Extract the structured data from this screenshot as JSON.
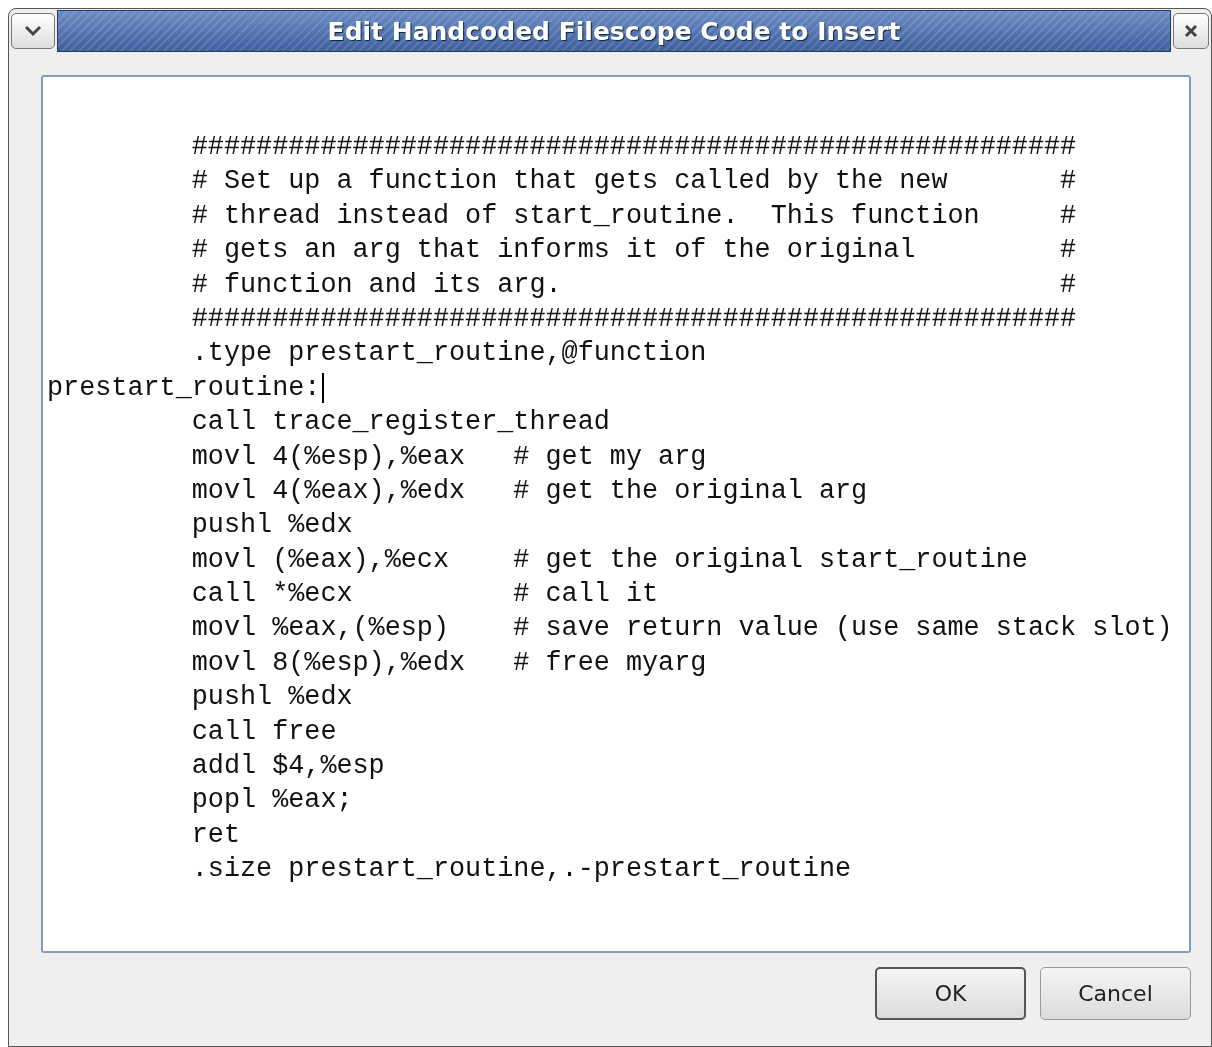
{
  "window": {
    "title": "Edit Handcoded Filescope Code to Insert"
  },
  "editor": {
    "lines": [
      {
        "text": "\t#######################################################",
        "cursor": false
      },
      {
        "text": "\t# Set up a function that gets called by the new       #",
        "cursor": false
      },
      {
        "text": "\t# thread instead of start_routine.  This function     #",
        "cursor": false
      },
      {
        "text": "\t# gets an arg that informs it of the original         #",
        "cursor": false
      },
      {
        "text": "\t# function and its arg.                               #",
        "cursor": false
      },
      {
        "text": "\t#######################################################",
        "cursor": false
      },
      {
        "text": "\t.type prestart_routine,@function",
        "cursor": false
      },
      {
        "text": "prestart_routine:",
        "cursor": true
      },
      {
        "text": "\tcall trace_register_thread",
        "cursor": false
      },
      {
        "text": "\tmovl 4(%esp),%eax   # get my arg",
        "cursor": false
      },
      {
        "text": "\tmovl 4(%eax),%edx   # get the original arg",
        "cursor": false
      },
      {
        "text": "\tpushl %edx",
        "cursor": false
      },
      {
        "text": "\tmovl (%eax),%ecx    # get the original start_routine",
        "cursor": false
      },
      {
        "text": "\tcall *%ecx          # call it",
        "cursor": false
      },
      {
        "text": "\tmovl %eax,(%esp)    # save return value (use same stack slot)",
        "cursor": false
      },
      {
        "text": "\tmovl 8(%esp),%edx   # free myarg",
        "cursor": false
      },
      {
        "text": "\tpushl %edx",
        "cursor": false
      },
      {
        "text": "\tcall free",
        "cursor": false
      },
      {
        "text": "\taddl $4,%esp",
        "cursor": false
      },
      {
        "text": "\tpopl %eax;",
        "cursor": false
      },
      {
        "text": "\tret",
        "cursor": false
      },
      {
        "text": "\t.size prestart_routine,.-prestart_routine",
        "cursor": false
      }
    ]
  },
  "buttons": [
    {
      "label": "OK",
      "kind": "default"
    },
    {
      "label": "Cancel",
      "kind": "normal"
    }
  ]
}
